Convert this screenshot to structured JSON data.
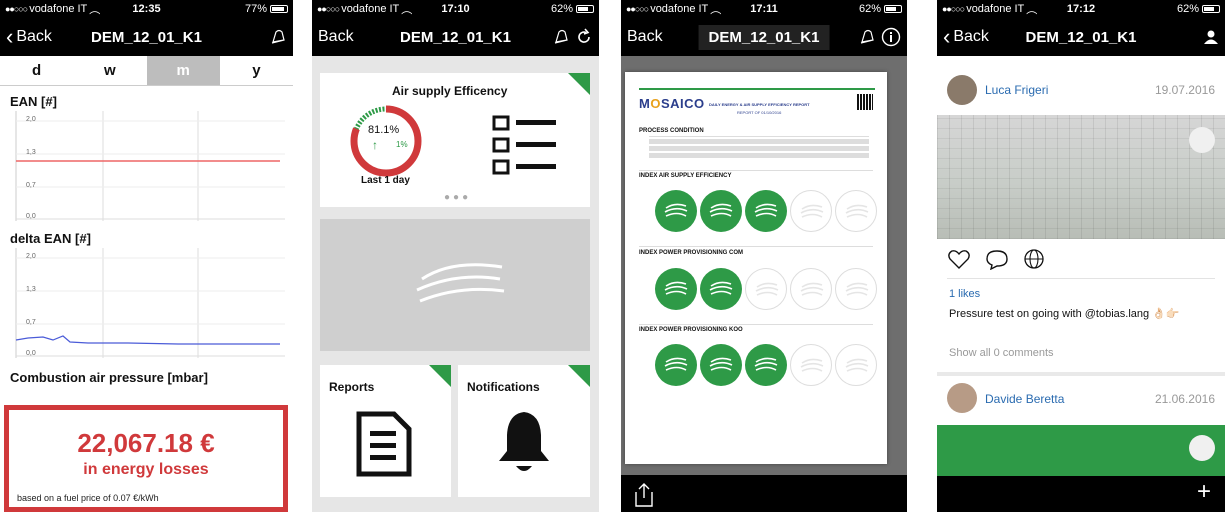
{
  "screen1": {
    "status": {
      "carrier": "vodafone IT",
      "time": "12:35",
      "battery": "77%",
      "battery_level": 0.77
    },
    "nav": {
      "back": "Back",
      "title": "DEM_12_01_K1"
    },
    "periods": [
      "d",
      "w",
      "m",
      "y"
    ],
    "selected_period": "m",
    "chart1": {
      "title": "EAN [#]",
      "ticks": [
        "2,0",
        "1,3",
        "0,7",
        "0,0"
      ]
    },
    "chart2": {
      "title": "delta EAN [#]",
      "ticks": [
        "2,0",
        "1,3",
        "0,7",
        "0,0"
      ]
    },
    "section3_title": "Combustion air pressure [mbar]",
    "loss": {
      "amount": "22,067.18 €",
      "label": "in energy losses",
      "note": "based on a fuel price of 0.07 €/kWh"
    },
    "colors": {
      "accent": "#d0393b",
      "line2": "#4a5bd8"
    }
  },
  "screen2": {
    "status": {
      "carrier": "vodafone IT",
      "time": "17:10",
      "battery": "62%",
      "battery_level": 0.62
    },
    "nav": {
      "back": "Back",
      "title": "DEM_12_01_K1"
    },
    "efficiency": {
      "title": "Air supply Efficency",
      "value": "81.1%",
      "delta": "1%",
      "period": "Last 1 day",
      "level": 0.811
    },
    "reports_label": "Reports",
    "notifications_label": "Notifications",
    "colors": {
      "corner": "#2e9a47"
    }
  },
  "screen3": {
    "status": {
      "carrier": "vodafone IT",
      "time": "17:11",
      "battery": "62%",
      "battery_level": 0.62
    },
    "nav": {
      "back": "Back",
      "title": "DEM_12_01_K1"
    },
    "doc": {
      "logo_main": "M",
      "logo_o": "O",
      "logo_rest": "SAICO",
      "report_title": "DAILY ENERGY & AIR SUPPLY EFFICIENCY REPORT",
      "report_of": "REPORT OF 01/10/2016",
      "process_condition": "PROCESS CONDITION",
      "index1": "INDEX AIR SUPPLY EFFICIENCY",
      "index2": "INDEX POWER PROVISIONING COM",
      "index3": "INDEX POWER PROVISIONING KOO",
      "index1_on": 3,
      "index2_on": 2,
      "index3_on": 3
    }
  },
  "screen4": {
    "status": {
      "carrier": "vodafone IT",
      "time": "17:12",
      "battery": "62%",
      "battery_level": 0.62
    },
    "nav": {
      "back": "Back",
      "title": "DEM_12_01_K1"
    },
    "post1": {
      "user": "Luca Frigeri",
      "date": "19.07.2016",
      "likes": "1 likes",
      "caption": "Pressure test on going with @tobias.lang 👌🏻👉🏻",
      "comments": "Show all 0 comments"
    },
    "post2": {
      "user": "Davide Beretta",
      "date": "21.06.2016"
    }
  }
}
